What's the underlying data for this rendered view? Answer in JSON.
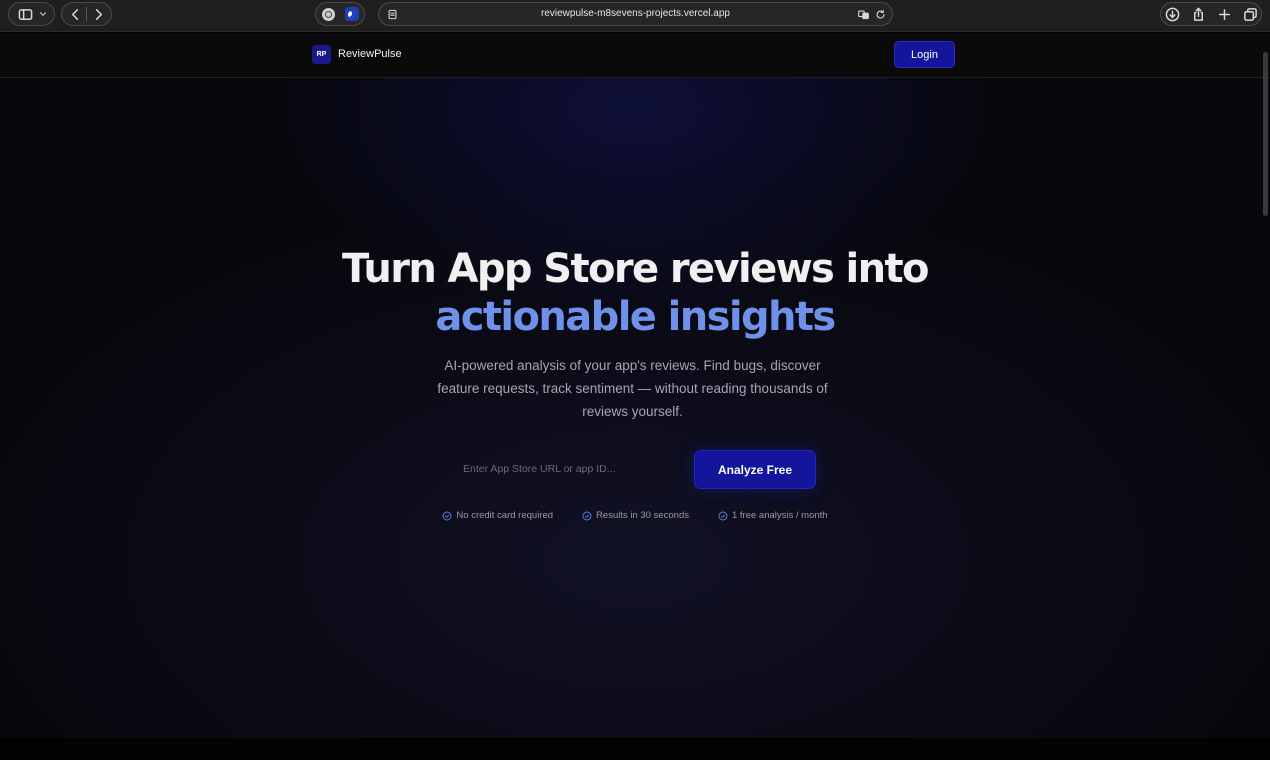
{
  "browser": {
    "url": "reviewpulse-m8sevens-projects.vercel.app"
  },
  "header": {
    "logo_text": "RP",
    "brand": "ReviewPulse",
    "login_label": "Login"
  },
  "hero": {
    "title_line1": "Turn App Store reviews into",
    "title_line2": "actionable insights",
    "subtitle": "AI-powered analysis of your app's reviews. Find bugs, discover feature requests, track sentiment — without reading thousands of reviews yourself.",
    "input_placeholder": "Enter App Store URL or app ID...",
    "cta_label": "Analyze Free",
    "features": [
      "No credit card required",
      "Results in 30 seconds",
      "1 free analysis / month"
    ]
  },
  "colors": {
    "accent": "#13169a",
    "headline_highlight": "#6f91ea",
    "background": "#07070d"
  }
}
